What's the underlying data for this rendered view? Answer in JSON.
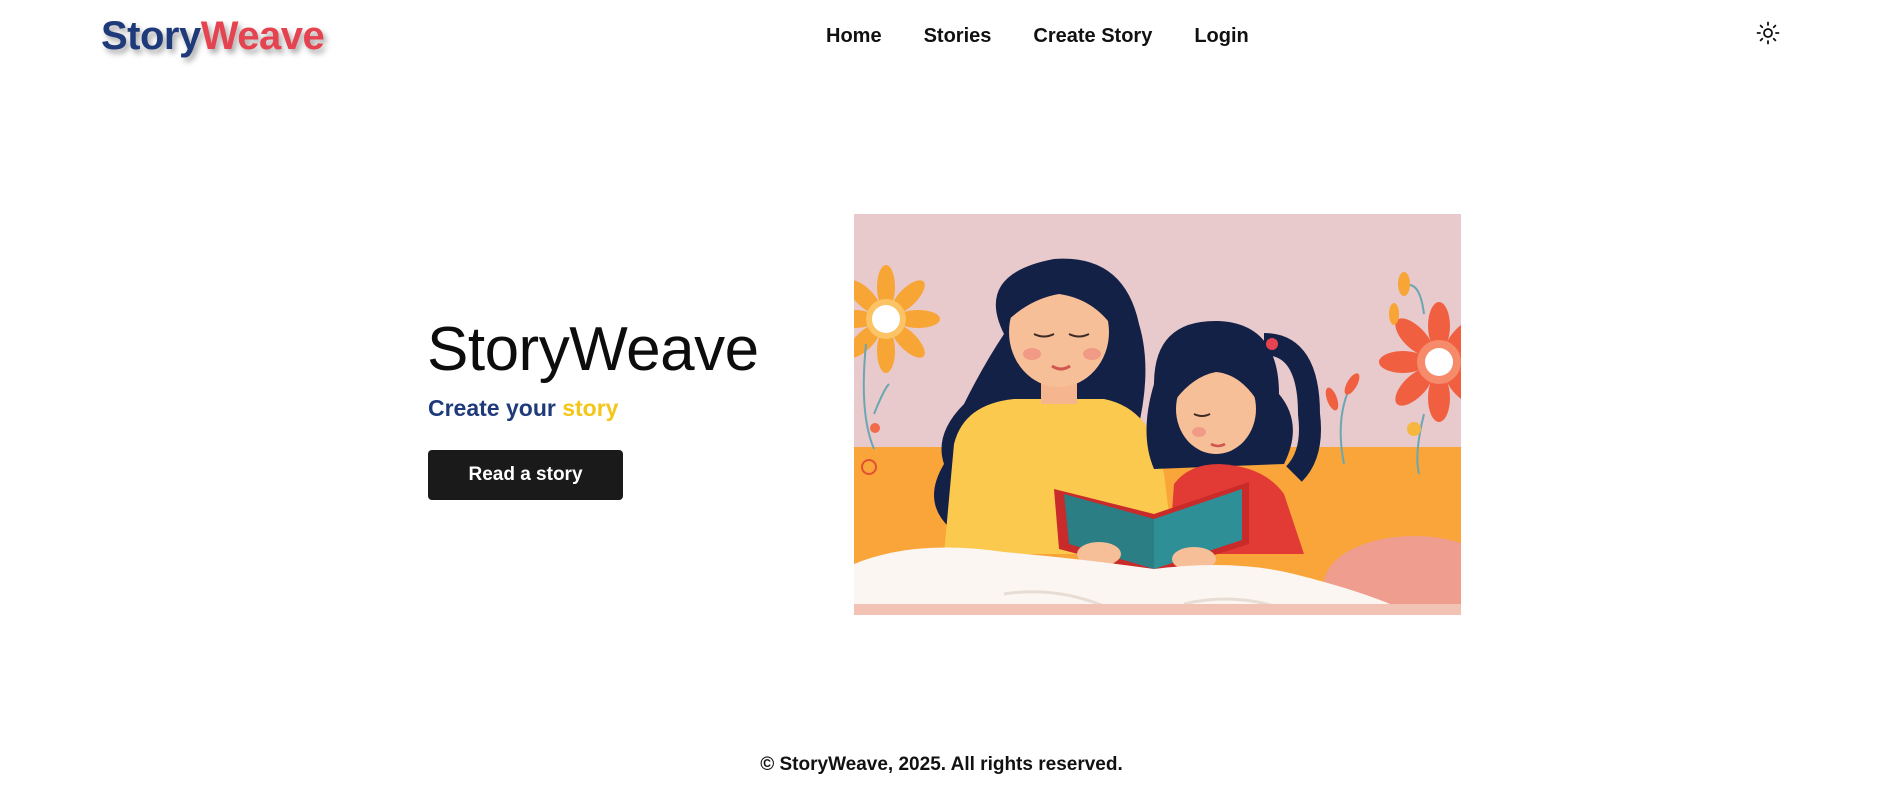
{
  "header": {
    "logo": {
      "part_a": "Story",
      "part_b": "Weave",
      "color_a": "#1f3a7a",
      "color_b": "#e5434f"
    },
    "nav": [
      {
        "label": "Home"
      },
      {
        "label": "Stories"
      },
      {
        "label": "Create Story"
      },
      {
        "label": "Login"
      }
    ],
    "theme_toggle_icon": "sun-icon"
  },
  "hero": {
    "title": "StoryWeave",
    "subtitle_a": "Create your",
    "subtitle_b": "story",
    "subtitle_color_a": "#1f3a7a",
    "subtitle_color_b": "#f5c518",
    "cta_label": "Read a story",
    "image_icon": "mother-daughter-reading-illustration"
  },
  "footer": {
    "text": "© StoryWeave, 2025. All rights reserved."
  }
}
